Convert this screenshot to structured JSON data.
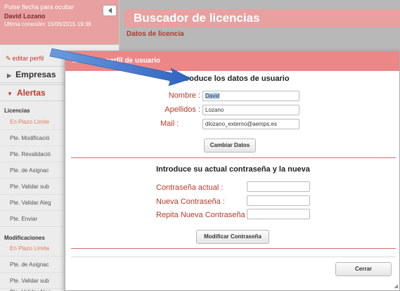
{
  "sidebar": {
    "hide_hint": "Pulse flecha para ocultar",
    "user_name": "David Lozano",
    "last_login": "Última conexión: 15/06/2015 19:38",
    "edit_profile": "editar perfil",
    "menu": {
      "empresas": "Empresas",
      "alertas": "Alertas"
    },
    "licencias": {
      "title": "Licencias",
      "items": [
        "En Plazo Límite",
        "Pte. Modificació",
        "Pte. Revalidació",
        "Pte. de Asignac",
        "Pte. Validar sub",
        "Pte. Validar Aleg",
        "Pte. Enviar"
      ]
    },
    "modificaciones": {
      "title": "Modificaciones",
      "items": [
        "En Plazo Límite",
        "Pte. de Asignac",
        "Pte. Validar sub",
        "Pte. Validar Aleg"
      ]
    }
  },
  "main": {
    "title": "Buscador de licencias",
    "subtitle": "Datos de licencia"
  },
  "modal": {
    "title": "Modificar perfil de usuario",
    "user_section_title": "Introduce los datos de usuario",
    "fields": {
      "nombre_label": "Nombre :",
      "nombre_value": "David",
      "apellidos_label": "Apellidos :",
      "apellidos_value": "Lozano",
      "mail_label": "Mail :",
      "mail_value": "dlozano_externo@aemps.es"
    },
    "change_data_button": "Cambiar Datos",
    "password_section_title": "Introduce su actual contraseña y la nueva",
    "password_fields": {
      "current_label": "Contraseña actual :",
      "new_label": "Nueva Contraseña :",
      "repeat_label": "Repita Nueva Contraseña :"
    },
    "change_password_button": "Modificar Contraseña",
    "close_button": "Cerrar"
  },
  "colors": {
    "accent": "#e8a0a0",
    "modal_header": "#ec8787",
    "label_red": "#b23a2a",
    "arrow": "#3a6fc9"
  }
}
